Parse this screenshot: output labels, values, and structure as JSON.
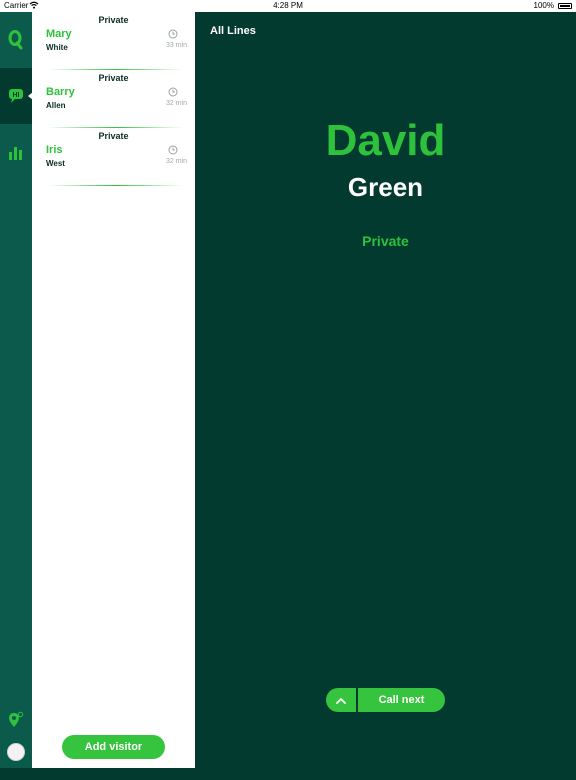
{
  "status_bar": {
    "carrier": "Carrier",
    "time": "4:28 PM",
    "battery": "100%"
  },
  "rail": {
    "icons": [
      "queue-logo-icon",
      "chat-hi-icon",
      "stats-icon",
      "location-icon",
      "avatar"
    ]
  },
  "visitors": [
    {
      "tag": "Private",
      "first_name": "Mary",
      "last_name": "White",
      "wait": "33 min"
    },
    {
      "tag": "Private",
      "first_name": "Barry",
      "last_name": "Allen",
      "wait": "32 min"
    },
    {
      "tag": "Private",
      "first_name": "Iris",
      "last_name": "West",
      "wait": "32 min"
    }
  ],
  "list_actions": {
    "add_visitor_label": "Add visitor"
  },
  "main": {
    "header_title": "All Lines",
    "current_first_name": "David",
    "current_last_name": "Green",
    "current_queue": "Private",
    "call_next_label": "Call next"
  },
  "colors": {
    "accent_green": "#2ec23c",
    "button_green": "#36c43e",
    "dark_background": "#033a2f",
    "rail_background": "#0c5a4c"
  }
}
